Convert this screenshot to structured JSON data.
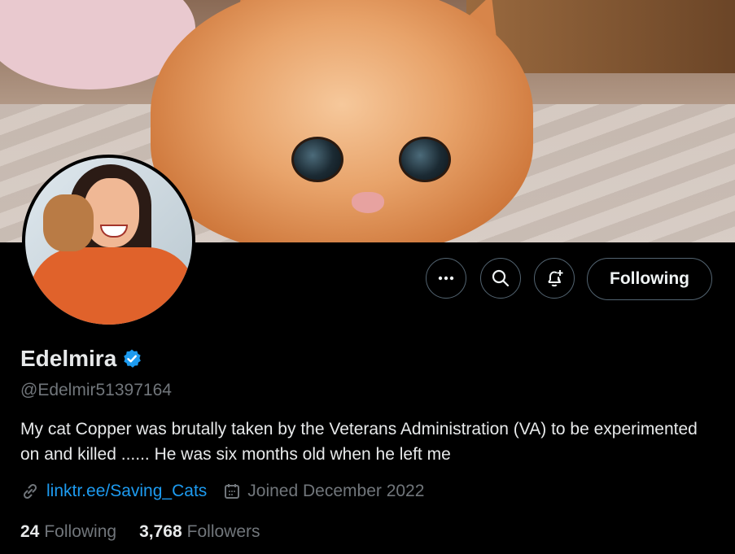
{
  "profile": {
    "name": "Edelmira",
    "handle": "@Edelmir51397164",
    "bio": "My cat Copper was brutally taken by the Veterans Administration (VA) to be experimented on and killed ...... He was six months old when he left me",
    "link": "linktr.ee/Saving_Cats",
    "joined": "Joined December 2022",
    "verified": true,
    "verified_color": "#1d9bf0"
  },
  "actions": {
    "more_icon": "more-icon",
    "search_icon": "search-icon",
    "notify_icon": "bell-plus-icon",
    "follow_label": "Following"
  },
  "stats": {
    "following_count": "24",
    "following_label": "Following",
    "followers_count": "3,768",
    "followers_label": "Followers"
  },
  "colors": {
    "background": "#000000",
    "text": "#e7e9ea",
    "muted": "#71767b",
    "accent": "#1d9bf0"
  }
}
